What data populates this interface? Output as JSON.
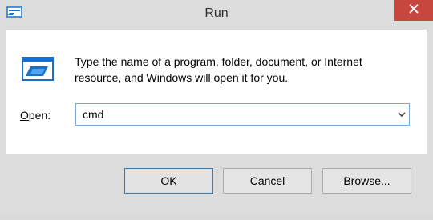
{
  "window": {
    "title": "Run",
    "close_icon": "close-icon",
    "app_icon": "run-dialog-icon"
  },
  "content": {
    "icon": "run-program-icon",
    "description": "Type the name of a program, folder, document, or Internet resource, and Windows will open it for you.",
    "open_label_prefix": "",
    "open_label_accel": "O",
    "open_label_rest": "pen:",
    "open_value": "cmd",
    "dropdown_icon": "chevron-down-icon"
  },
  "buttons": {
    "ok_label": "OK",
    "cancel_label": "Cancel",
    "browse_accel": "B",
    "browse_rest": "rowse..."
  },
  "colors": {
    "close_red": "#c7463d",
    "focus_border": "#3c7fb1",
    "combo_border": "#7aa7d6"
  }
}
